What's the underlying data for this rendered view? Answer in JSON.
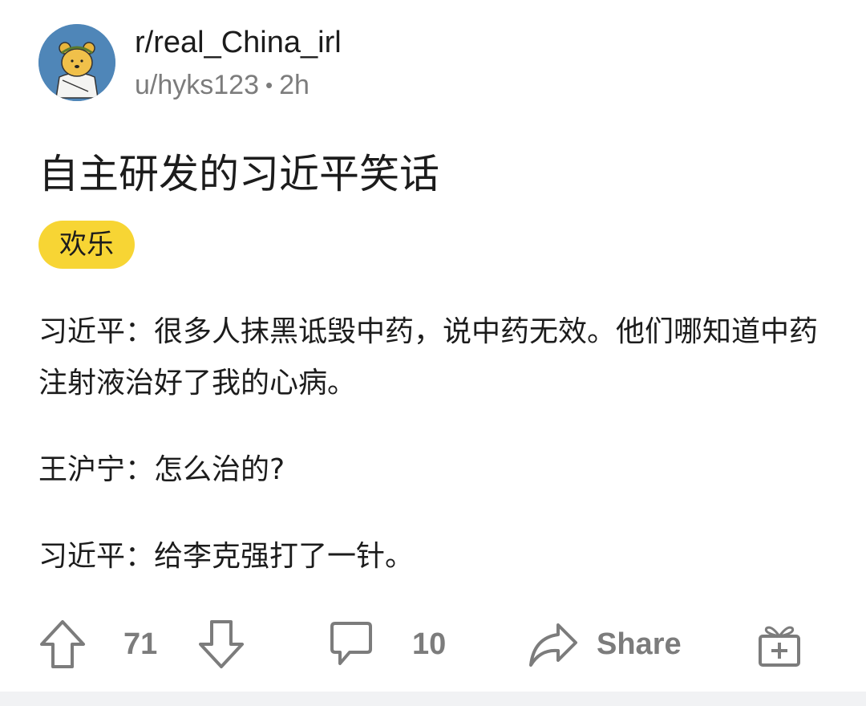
{
  "post": {
    "subreddit": "r/real_China_irl",
    "author": "u/hyks123",
    "separator": "•",
    "age": "2h",
    "title": "自主研发的习近平笑话",
    "flair": "欢乐",
    "body": [
      "习近平：很多人抹黑诋毁中药，说中药无效。他们哪知道中药注射液治好了我的心病。",
      "王沪宁：怎么治的?",
      "习近平：给李克强打了一针。"
    ]
  },
  "actions": {
    "upvote_icon": "arrow-up-icon",
    "score": "71",
    "downvote_icon": "arrow-down-icon",
    "comment_icon": "comment-bubble-icon",
    "comments": "10",
    "share_icon": "share-arrow-icon",
    "share_label": "Share",
    "award_icon": "gift-icon"
  },
  "colors": {
    "flair_bg": "#f7d534",
    "avatar_bg": "#4f86b8",
    "muted_text": "#7c7c7c"
  }
}
